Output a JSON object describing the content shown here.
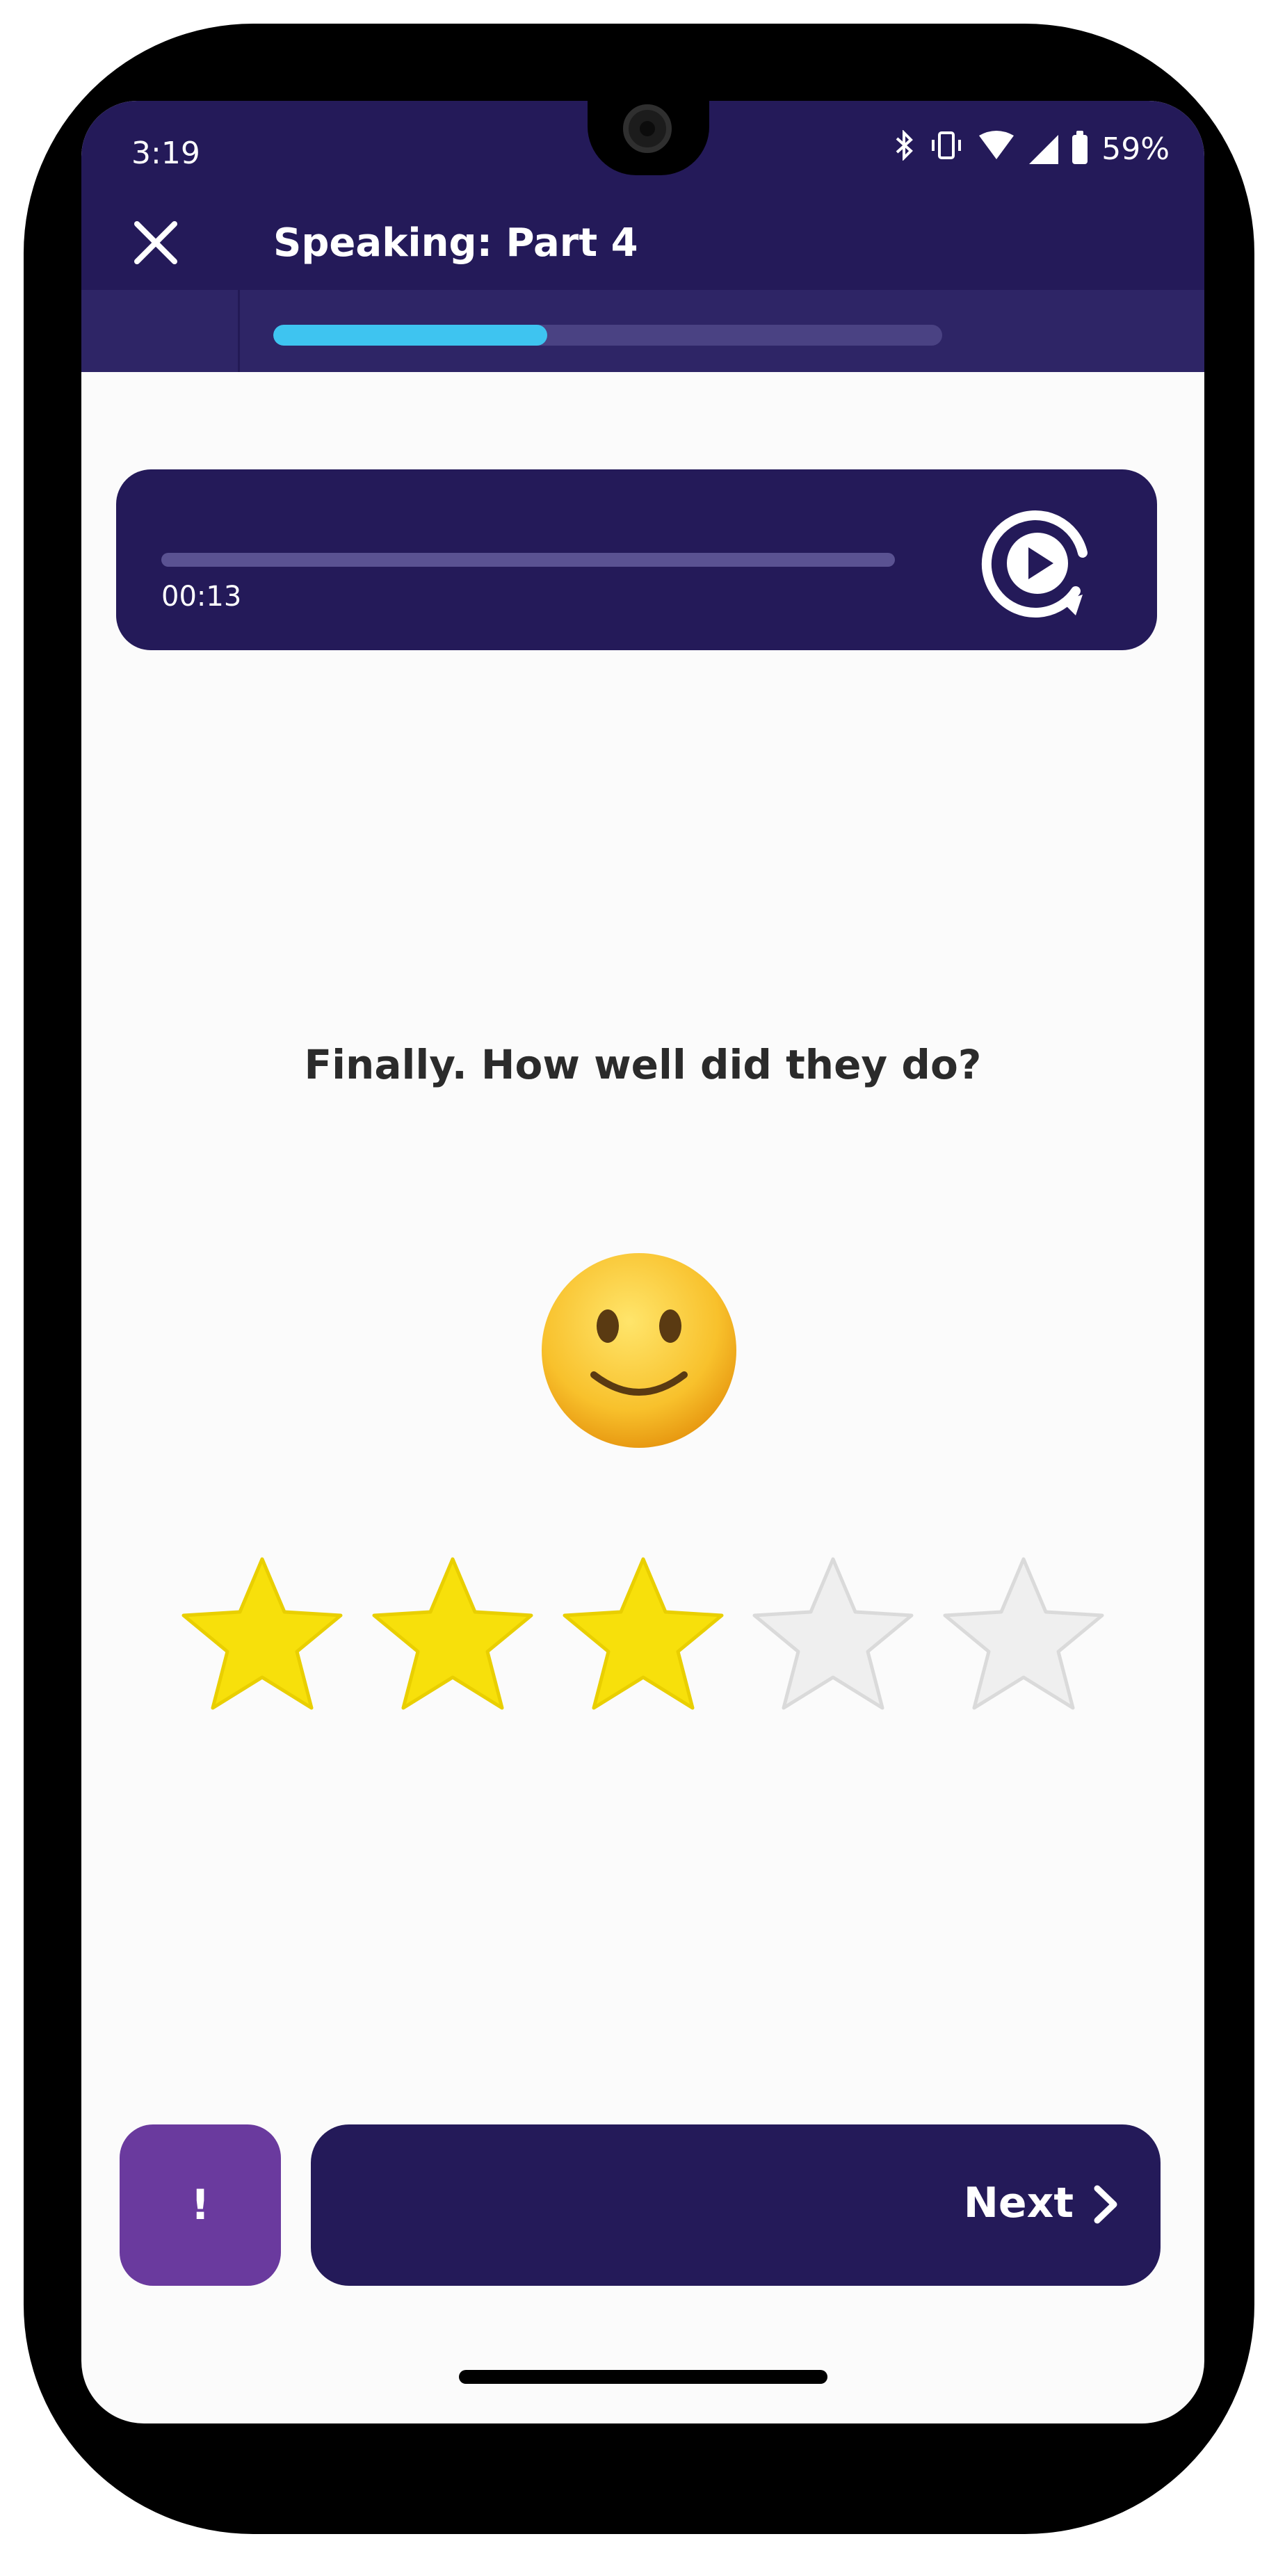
{
  "status_bar": {
    "time": "3:19",
    "battery_percent": "59%",
    "icons": [
      "bluetooth-icon",
      "vibrate-icon",
      "wifi-icon",
      "signal-icon",
      "battery-icon"
    ]
  },
  "header": {
    "title": "Speaking: Part 4",
    "close_icon": "close-icon",
    "progress": 0.41
  },
  "audio_player": {
    "elapsed": "00:13",
    "replay_icon": "replay-icon"
  },
  "question": {
    "text": "Finally. How well did they do?"
  },
  "rating": {
    "emoji": "slightly-smiling-face",
    "value": 3,
    "max": 5
  },
  "actions": {
    "report_label": "!",
    "next_label": "Next"
  },
  "colors": {
    "brand_dark": "#241a59",
    "progress_accent": "#3ec4f0",
    "star_filled": "#f7e00b",
    "star_empty": "#efefef",
    "report_button": "#6a3a9e"
  }
}
